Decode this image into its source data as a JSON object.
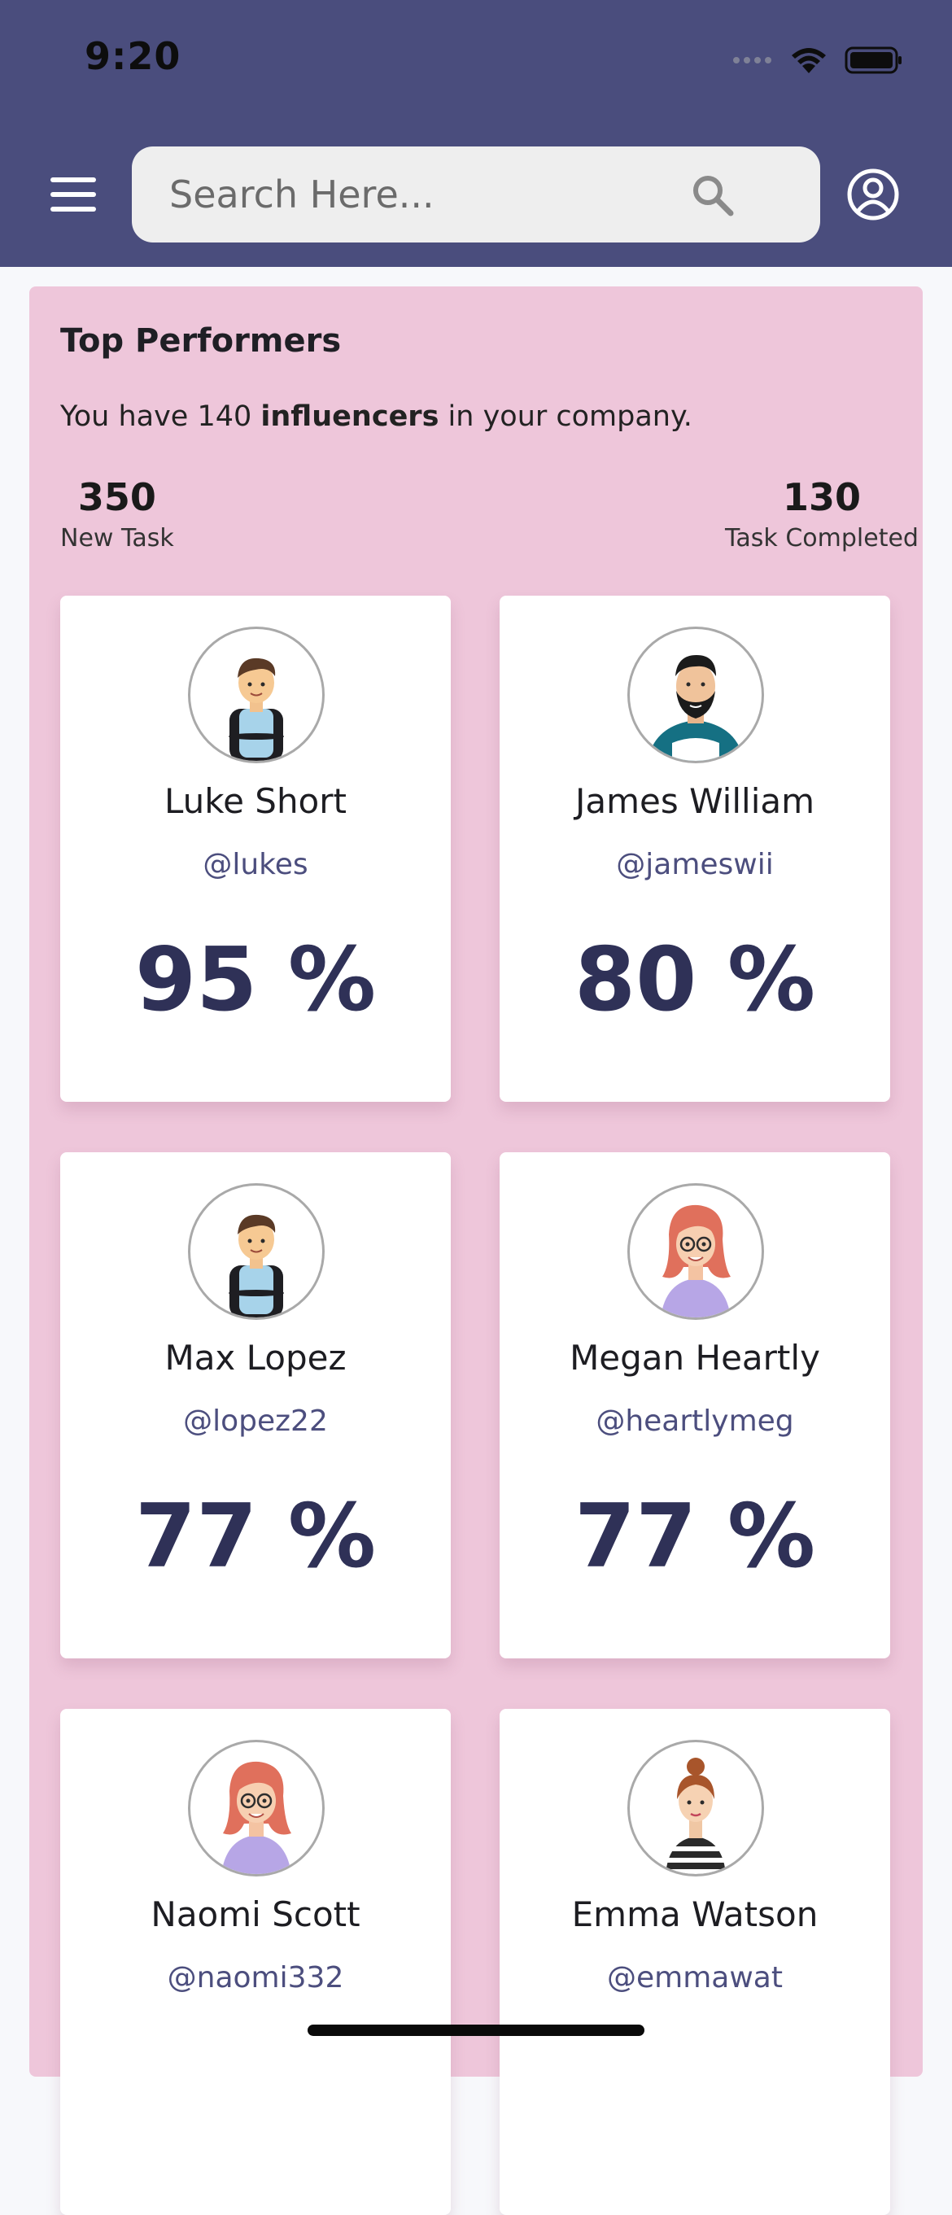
{
  "status_bar": {
    "time": "9:20"
  },
  "header": {
    "search": {
      "placeholder": "Search Here..."
    },
    "icons": [
      "menu-icon",
      "search-icon",
      "profile-icon"
    ]
  },
  "summary": {
    "title": "Top Performers",
    "subtitle_prefix": "You have 140 ",
    "subtitle_bold": "influencers",
    "subtitle_suffix": " in your company.",
    "new_task_value": "350",
    "new_task_label": "New Task",
    "completed_value": "130",
    "completed_label": "Task Completed"
  },
  "performers": [
    {
      "name": "Luke Short",
      "handle": "@lukes",
      "score": "95 %",
      "avatar": "man-vest-avatar"
    },
    {
      "name": "James William",
      "handle": "@jameswii",
      "score": "80 %",
      "avatar": "bearded-man-avatar"
    },
    {
      "name": "Max Lopez",
      "handle": "@lopez22",
      "score": "77 %",
      "avatar": "man-vest-avatar"
    },
    {
      "name": "Megan Heartly",
      "handle": "@heartlymeg",
      "score": "77 %",
      "avatar": "red-hair-woman-avatar"
    },
    {
      "name": "Naomi Scott",
      "handle": "@naomi332",
      "score": "",
      "avatar": "red-hair-woman-avatar"
    },
    {
      "name": "Emma Watson",
      "handle": "@emmawat",
      "score": "",
      "avatar": "bun-hair-woman-avatar"
    }
  ],
  "colors": {
    "header_bg": "#4a4d7d",
    "panel_bg": "#eec6da",
    "handle": "#4c4e7e",
    "percent": "#2f3157"
  }
}
